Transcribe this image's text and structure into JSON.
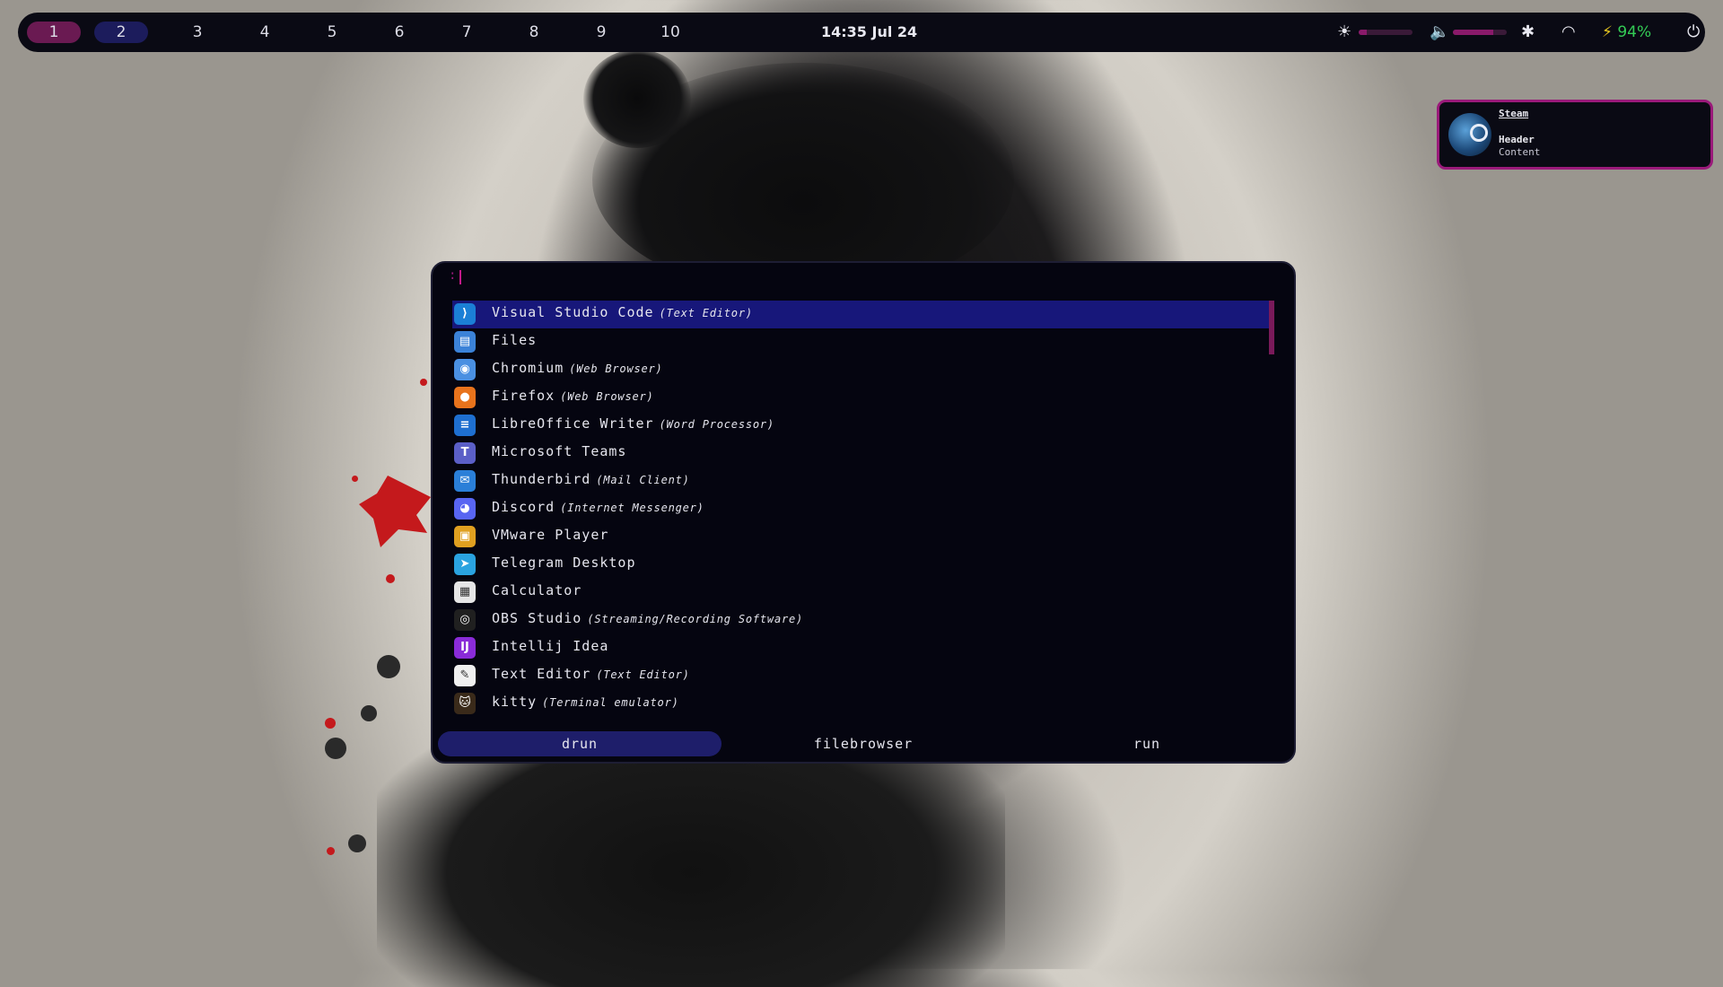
{
  "topbar": {
    "workspaces": [
      "1",
      "2",
      "3",
      "4",
      "5",
      "6",
      "7",
      "8",
      "9",
      "10"
    ],
    "active_workspace": "1",
    "clock": "14:35 Jul 24",
    "brightness_level": 0.15,
    "volume_level": 0.75,
    "battery": "94%",
    "icons": [
      "brightness-icon",
      "volume-icon",
      "bluetooth-icon",
      "wifi-icon",
      "battery-charging-icon",
      "power-icon"
    ],
    "colors": {
      "active_ws": "#6a1a52",
      "secondary_ws": "#1c1c5c",
      "battery": "#33cc55",
      "slider": "#8a1a6a"
    }
  },
  "notification": {
    "app": "Steam",
    "header": "Header",
    "content": "Content",
    "border_color": "#9a1a7a"
  },
  "launcher": {
    "prompt": ":",
    "items": [
      {
        "name": "Visual Studio Code",
        "desc": "(Text Editor)",
        "icon": "vscode-icon"
      },
      {
        "name": "Files",
        "desc": "",
        "icon": "files-icon"
      },
      {
        "name": "Chromium",
        "desc": "(Web Browser)",
        "icon": "chromium-icon"
      },
      {
        "name": "Firefox",
        "desc": "(Web Browser)",
        "icon": "firefox-icon"
      },
      {
        "name": "LibreOffice Writer",
        "desc": "(Word Processor)",
        "icon": "libreoffice-writer-icon"
      },
      {
        "name": "Microsoft Teams",
        "desc": "",
        "icon": "teams-icon"
      },
      {
        "name": "Thunderbird",
        "desc": "(Mail Client)",
        "icon": "thunderbird-icon"
      },
      {
        "name": "Discord",
        "desc": "(Internet Messenger)",
        "icon": "discord-icon"
      },
      {
        "name": "VMware Player",
        "desc": "",
        "icon": "vmware-icon"
      },
      {
        "name": "Telegram Desktop",
        "desc": "",
        "icon": "telegram-icon"
      },
      {
        "name": "Calculator",
        "desc": "",
        "icon": "calculator-icon"
      },
      {
        "name": "OBS Studio",
        "desc": "(Streaming/Recording Software)",
        "icon": "obs-icon"
      },
      {
        "name": "Intellij Idea",
        "desc": "",
        "icon": "intellij-icon"
      },
      {
        "name": "Text Editor",
        "desc": "(Text Editor)",
        "icon": "text-editor-icon"
      },
      {
        "name": "kitty",
        "desc": "(Terminal emulator)",
        "icon": "kitty-icon"
      }
    ],
    "selected_index": 0,
    "modes": [
      "drun",
      "filebrowser",
      "run"
    ],
    "active_mode": "drun",
    "colors": {
      "selected_row": "#17177a",
      "active_mode": "#1e1e6a",
      "scrollbar": "#7a1a5a"
    }
  }
}
